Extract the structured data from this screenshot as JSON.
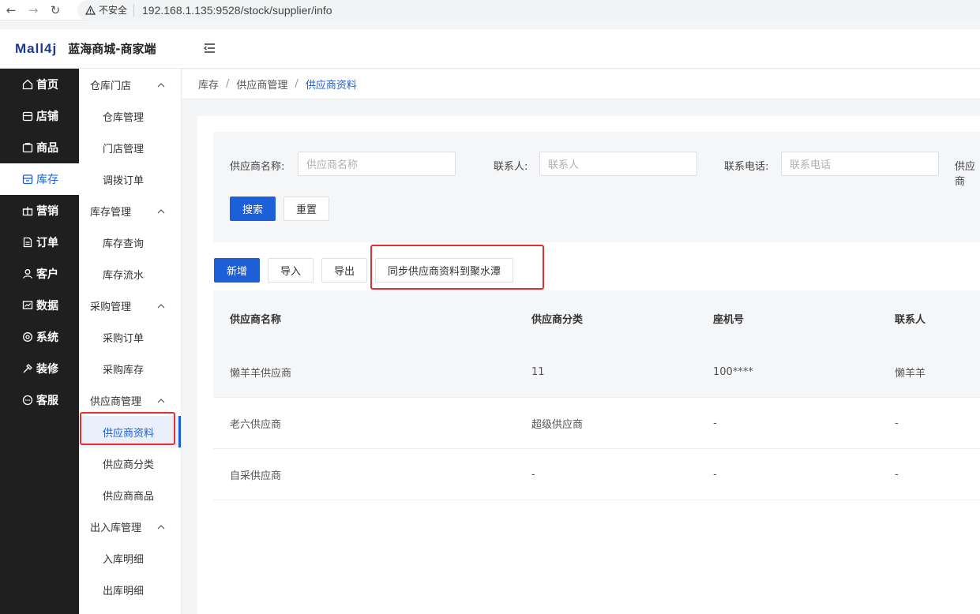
{
  "browser": {
    "security_label": "不安全",
    "url": "192.168.1.135:9528/stock/supplier/info"
  },
  "header": {
    "logo": "Mall4j",
    "shop_name": "蓝海商城-商家端"
  },
  "primary_nav": [
    {
      "label": "首页",
      "icon": "home-icon"
    },
    {
      "label": "店铺",
      "icon": "store-icon"
    },
    {
      "label": "商品",
      "icon": "goods-icon"
    },
    {
      "label": "库存",
      "icon": "inventory-icon"
    },
    {
      "label": "营销",
      "icon": "gift-icon"
    },
    {
      "label": "订单",
      "icon": "order-icon"
    },
    {
      "label": "客户",
      "icon": "customer-icon"
    },
    {
      "label": "数据",
      "icon": "data-icon"
    },
    {
      "label": "系统",
      "icon": "settings-icon"
    },
    {
      "label": "装修",
      "icon": "decorate-icon"
    },
    {
      "label": "客服",
      "icon": "chat-icon"
    }
  ],
  "secondary_nav": {
    "groups": [
      {
        "label": "仓库门店",
        "items": [
          "仓库管理",
          "门店管理",
          "调拨订单"
        ]
      },
      {
        "label": "库存管理",
        "items": [
          "库存查询",
          "库存流水"
        ]
      },
      {
        "label": "采购管理",
        "items": [
          "采购订单",
          "采购库存"
        ]
      },
      {
        "label": "供应商管理",
        "items": [
          "供应商资料",
          "供应商分类",
          "供应商商品"
        ]
      },
      {
        "label": "出入库管理",
        "items": [
          "入库明细",
          "出库明细"
        ]
      }
    ]
  },
  "breadcrumb": [
    "库存",
    "供应商管理",
    "供应商资料"
  ],
  "search": {
    "name_label": "供应商名称:",
    "name_placeholder": "供应商名称",
    "contact_label": "联系人:",
    "contact_placeholder": "联系人",
    "phone_label": "联系电话:",
    "phone_placeholder": "联系电话",
    "extra_label": "供应商",
    "search_button": "搜索",
    "reset_button": "重置"
  },
  "toolbar": {
    "add": "新增",
    "import": "导入",
    "export": "导出",
    "sync": "同步供应商资料到聚水潭"
  },
  "table": {
    "columns": [
      "供应商名称",
      "供应商分类",
      "座机号",
      "联系人"
    ],
    "rows": [
      [
        "懒羊羊供应商",
        "11",
        "100****",
        "懒羊羊"
      ],
      [
        "老六供应商",
        "超级供应商",
        "-",
        "-"
      ],
      [
        "自采供应商",
        "-",
        "-",
        "-"
      ]
    ]
  },
  "colors": {
    "primary": "#1d5fd6",
    "highlight": "#e52e2e",
    "sidebar_bg": "#1f1f1f"
  }
}
